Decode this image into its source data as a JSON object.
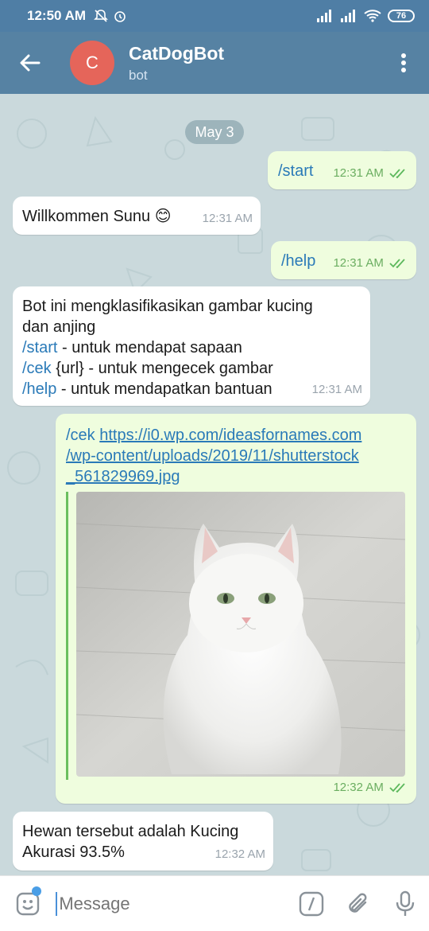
{
  "status_bar": {
    "time": "12:50 AM",
    "battery": "76",
    "icons": [
      "mute-icon",
      "alarm-icon",
      "signal-icon",
      "signal-icon",
      "wifi-icon"
    ]
  },
  "header": {
    "avatar_letter": "C",
    "title": "CatDogBot",
    "subtitle": "bot",
    "colors": {
      "bar": "#5682a3",
      "avatar": "#e5655a"
    }
  },
  "chat": {
    "date_chip": "May 3",
    "messages": [
      {
        "dir": "out",
        "text": "/start",
        "time": "12:31 AM"
      },
      {
        "dir": "in",
        "text": "Willkommen Sunu",
        "emoji": "😊",
        "time": "12:31 AM"
      },
      {
        "dir": "out",
        "text": "/help",
        "time": "12:31 AM"
      },
      {
        "dir": "in",
        "line1": "Bot ini mengklasifikasikan gambar kucing",
        "line2": "dan anjing",
        "cmd_start": "/start",
        "start_desc": " - untuk mendapat sapaan",
        "cmd_cek": "/cek",
        "cek_desc": " {url} - untuk mengecek gambar",
        "cmd_help": "/help",
        "help_desc": " - untuk mendapatkan bantuan",
        "time": "12:31 AM"
      },
      {
        "dir": "out",
        "cmd": "/cek",
        "url_line1": "https://i0.wp.com/ideasfornames.com",
        "url_line2": "/wp-content/uploads/2019/11/shutterstock",
        "url_line3": "_561829969.jpg",
        "time": "12:32 AM"
      },
      {
        "dir": "in",
        "line1": "Hewan tersebut adalah Kucing",
        "line2": "Akurasi 93.5%",
        "time": "12:32 AM"
      }
    ]
  },
  "input": {
    "placeholder": "Message"
  }
}
